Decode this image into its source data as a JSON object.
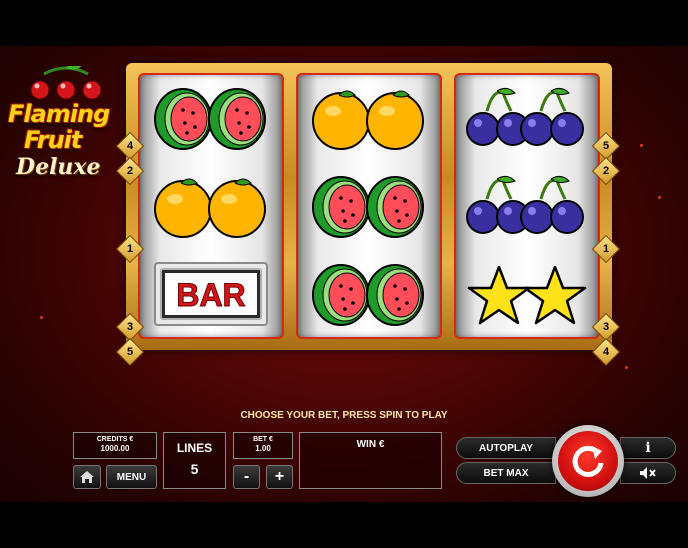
{
  "game": {
    "logo_line1": "Flaming",
    "logo_line2": "Fruit",
    "logo_line3": "Deluxe"
  },
  "reels": [
    [
      "watermelon",
      "orange",
      "bar"
    ],
    [
      "orange",
      "watermelon",
      "watermelon"
    ],
    [
      "plum",
      "plum",
      "star"
    ]
  ],
  "bar_label": "BAR",
  "line_markers": {
    "left": [
      "4",
      "2",
      "1",
      "3",
      "5"
    ],
    "right": [
      "5",
      "2",
      "1",
      "3",
      "4"
    ]
  },
  "prompt": "CHOOSE YOUR BET, PRESS SPIN TO PLAY",
  "panel": {
    "credits_label": "CREDITS €",
    "credits_value": "1000.00",
    "lines_label": "LINES",
    "lines_value": "5",
    "bet_label": "BET €",
    "bet_value": "1.00",
    "win_label": "WIN €",
    "menu_label": "MENU",
    "minus_label": "-",
    "plus_label": "+",
    "autoplay_label": "AUTOPLAY",
    "betmax_label": "BET MAX",
    "info_label": "i"
  },
  "icons": {
    "home": "home-icon",
    "spin": "spin-arrow-icon",
    "sound": "sound-muted-icon",
    "info": "info-icon"
  },
  "colors": {
    "reel_border": "#d42a0b",
    "frame_gold": "#c98a22",
    "spin_red": "#d10f0f",
    "prompt_text": "#ffe9a6"
  }
}
